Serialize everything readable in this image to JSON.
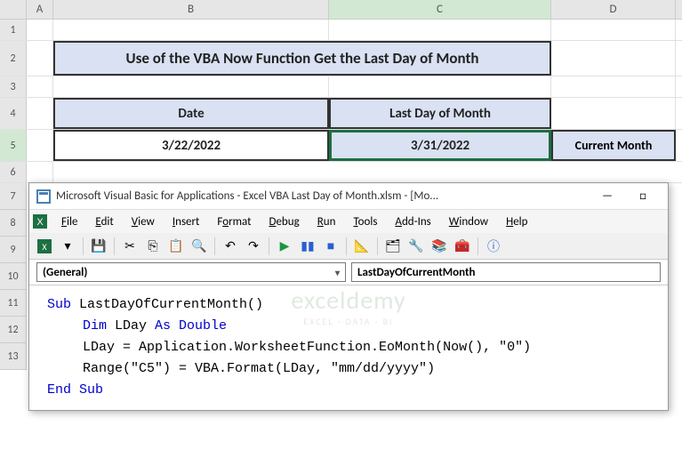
{
  "columns": [
    "A",
    "B",
    "C",
    "D"
  ],
  "rows": [
    "1",
    "2",
    "3",
    "4",
    "5",
    "6",
    "7",
    "8",
    "9",
    "10",
    "11",
    "12",
    "13"
  ],
  "sheet": {
    "title": "Use of the VBA Now Function Get the Last Day of Month",
    "header_date": "Date",
    "header_last": "Last Day of Month",
    "date_value": "3/22/2022",
    "last_day_value": "3/31/2022",
    "current_month": "Current Month"
  },
  "vba": {
    "title": "Microsoft Visual Basic for Applications - Excel VBA Last Day of Month.xlsm - [Mo...",
    "menu": {
      "file": "File",
      "edit": "Edit",
      "view": "View",
      "insert": "Insert",
      "format": "Format",
      "debug": "Debug",
      "run": "Run",
      "tools": "Tools",
      "addins": "Add-Ins",
      "window": "Window",
      "help": "Help"
    },
    "dropdown_left": "(General)",
    "dropdown_right": "LastDayOfCurrentMonth",
    "code": {
      "l1_kw": "Sub",
      "l1_name": " LastDayOfCurrentMonth()",
      "l2_kw1": "Dim",
      "l2_var": " LDay ",
      "l2_kw2": "As Double",
      "l3": "LDay = Application.WorksheetFunction.EoMonth(Now(), \"0\")",
      "l4": "Range(\"C5\") = VBA.Format(LDay, \"mm/dd/yyyy\")",
      "l5_kw": "End Sub"
    }
  },
  "watermark": {
    "big": "exceldemy",
    "small": "EXCEL · DATA · BI"
  }
}
